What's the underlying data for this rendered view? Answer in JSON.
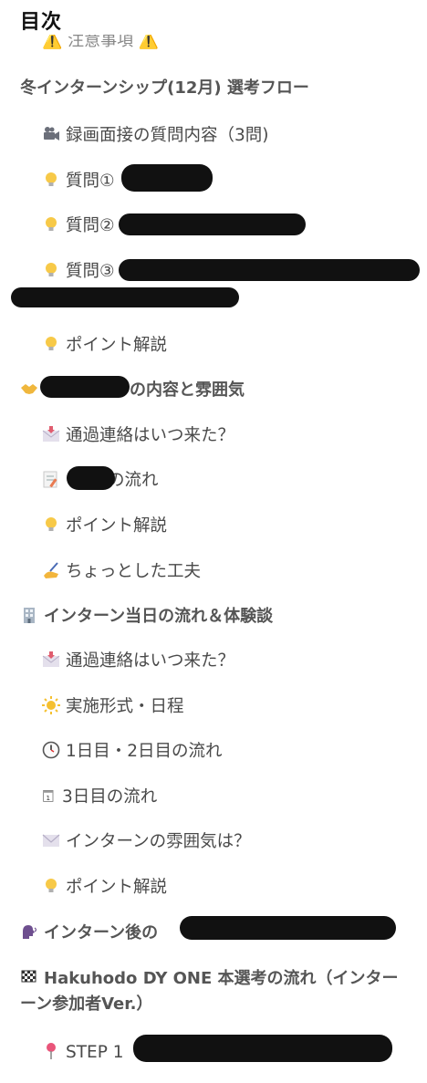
{
  "toc": {
    "title": "目次",
    "items": [
      {
        "text": "⚠️ 注意事項 ⚠️"
      },
      {
        "text": "冬インターンシップ(12月) 選考フロー"
      },
      {
        "text": "録画面接の質問内容（3問)"
      },
      {
        "text": "質問①"
      },
      {
        "text": "質問②"
      },
      {
        "text": "質問③"
      },
      {
        "text": "ポイント解説"
      },
      {
        "text": "の内容と雰囲気"
      },
      {
        "text": "通過連絡はいつ来た？"
      },
      {
        "text": "の流れ"
      },
      {
        "text": "ポイント解説"
      },
      {
        "text": "ちょっとした工夫"
      },
      {
        "text": "インターン当日の流れ＆体験談"
      },
      {
        "text": "通過連絡はいつ来た？"
      },
      {
        "text": "実施形式・日程"
      },
      {
        "text": "1日目・2日目の流れ"
      },
      {
        "text": "3日目の流れ"
      },
      {
        "text": "インターンの雰囲気は？"
      },
      {
        "text": "ポイント解説"
      },
      {
        "text": "インターン後の"
      },
      {
        "text": "Hakuhodo DY ONE 本選考の流れ（インター"
      },
      {
        "text": "ーン参加者Ver.）"
      },
      {
        "text": "STEP 1"
      }
    ]
  },
  "icons": {
    "camera": "movie-camera-icon",
    "bulb": "light-bulb-icon",
    "handshake": "handshake-icon",
    "envelope_arrow": "envelope-with-arrow-icon",
    "memo": "memo-icon",
    "writing": "writing-hand-icon",
    "building": "office-building-icon",
    "sun": "sun-icon",
    "clock": "clock-icon",
    "calendar": "calendar-icon",
    "envelope": "envelope-icon",
    "speaking": "speaking-head-icon",
    "flag": "checkered-flag-icon",
    "pin": "round-pushpin-icon"
  }
}
